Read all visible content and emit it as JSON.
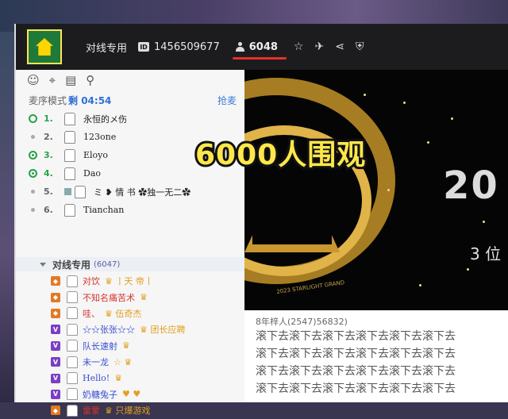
{
  "window": {
    "channel_name": "对线专用",
    "channel_id": "1456509677",
    "viewer_count": "6048",
    "icons": [
      "id-badge-icon",
      "person-icon",
      "star-icon",
      "plane-icon",
      "share-icon",
      "shield-icon"
    ]
  },
  "sidebar": {
    "icons": [
      "user-icon",
      "location-icon",
      "notes-icon",
      "search-icon"
    ],
    "queue_mode": "麦序模式",
    "queue_remaining_label": "剩 04:54",
    "queue_grab_label": "抢麦",
    "queue": [
      {
        "num": "1.",
        "name": "永恒的メ伤",
        "state": "ring"
      },
      {
        "num": "2.",
        "name": "123one",
        "state": "off"
      },
      {
        "num": "3.",
        "name": "Eloyo",
        "state": "on"
      },
      {
        "num": "4.",
        "name": "Dao",
        "state": "on"
      },
      {
        "num": "5.",
        "name": "ミ ❥ 情 书 ✿独一无二✿",
        "state": "off"
      },
      {
        "num": "6.",
        "name": "Tianchan",
        "state": "off"
      }
    ],
    "subchannel": {
      "name": "对线专用",
      "count": "(6047)"
    },
    "members": [
      {
        "level": "o",
        "name": "对饮",
        "deco": "♛ 丨天 帝丨"
      },
      {
        "level": "o",
        "name": "不知名痛苦术",
        "deco": "♛"
      },
      {
        "level": "o",
        "name": "哇、",
        "deco": "♛ 伍奇杰"
      },
      {
        "level": "v",
        "name": "☆☆张张☆☆",
        "deco": "♛ 团长应聘"
      },
      {
        "level": "v",
        "name": "队长速射",
        "deco": "♛"
      },
      {
        "level": "v",
        "name": "未一龙",
        "deco": "☆ ♛"
      },
      {
        "level": "v",
        "name": "Hello!",
        "deco": "♛"
      },
      {
        "level": "v",
        "name": "奶糖兔子",
        "deco": "♥ ♥"
      },
      {
        "level": "o",
        "name": "雷蒙",
        "deco": "♛ 只爆游戏"
      }
    ]
  },
  "video": {
    "title_fragment": "20",
    "sub_fragment": "3 位",
    "arc_text": "2023 STARLIGHT GRAND",
    "overlay_text": "6000人围观"
  },
  "chat": {
    "user_line": "8年梓人(2547)56832)",
    "spam_lines": [
      "滚下去滚下去滚下去滚下去滚下去滚下去",
      "滚下去滚下去滚下去滚下去滚下去滚下去",
      "滚下去滚下去滚下去滚下去滚下去滚下去",
      "滚下去滚下去滚下去滚下去滚下去滚下去"
    ]
  },
  "colors": {
    "accent_green": "#2aa24a",
    "highlight_red": "#e4312b",
    "overlay_yellow": "#ffe74a",
    "gold": "#c99630"
  }
}
